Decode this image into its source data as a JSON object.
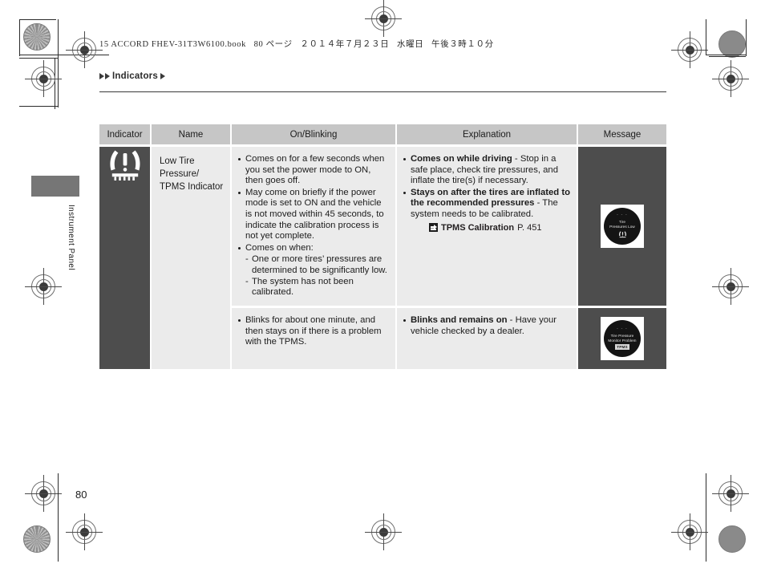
{
  "document": {
    "file_header": "15 ACCORD FHEV-31T3W6100.book   80 ページ   ２０１４年７月２３日   水曜日   午後３時１０分",
    "breadcrumb_label": "Indicators",
    "side_tab_label": "Instrument Panel",
    "page_number": "80"
  },
  "table": {
    "headers": [
      "Indicator",
      "Name",
      "On/Blinking",
      "Explanation",
      "Message"
    ],
    "rows": [
      {
        "indicator_icon": "tpms-low-tire-pressure-icon",
        "name": "Low Tire Pressure/\nTPMS Indicator",
        "on_blinking": [
          {
            "text": "Comes on for a few seconds when you set the power mode to ON, then goes off."
          },
          {
            "text": "May come on briefly if the power mode is set to ON and the vehicle is not moved within 45 seconds, to indicate the calibration process is not yet complete."
          },
          {
            "text": "Comes on when:",
            "sub": [
              "One or more tires’ pressures are determined to be significantly low.",
              "The system has not been calibrated."
            ]
          }
        ],
        "explanation": [
          {
            "bold": "Comes on while driving",
            "rest": " - Stop in a safe place, check tire pressures, and inflate the tire(s) if necessary."
          },
          {
            "bold": "Stays on after the tires are inflated to the recommended pressures",
            "rest": " - The system needs to be calibrated."
          }
        ],
        "cross_reference": {
          "icon": "jump-arrow-icon",
          "label": "TPMS Calibration",
          "page": "P. 451"
        },
        "message": {
          "dashes": "- - -",
          "lines": [
            "Tire",
            "Pressures Low"
          ],
          "icon": "tpms-low-tire-pressure-icon",
          "badge": ""
        }
      },
      {
        "indicator_icon": "",
        "name": "",
        "on_blinking": [
          {
            "text": "Blinks for about one minute, and then stays on if there is a problem with the TPMS."
          }
        ],
        "explanation": [
          {
            "bold": "Blinks and remains on",
            "rest": " - Have your vehicle checked by a dealer."
          }
        ],
        "cross_reference": null,
        "message": {
          "dashes": "- - -",
          "lines": [
            "Tire Pressure",
            "Monitor Problem"
          ],
          "icon": "",
          "badge": "TPMS"
        }
      }
    ]
  },
  "colors": {
    "header_bg": "#c6c6c6",
    "cell_bg": "#ebebeb",
    "dark_cell_bg": "#4d4d4d",
    "text": "#1c1c1c",
    "gauge_bg": "#141414"
  }
}
